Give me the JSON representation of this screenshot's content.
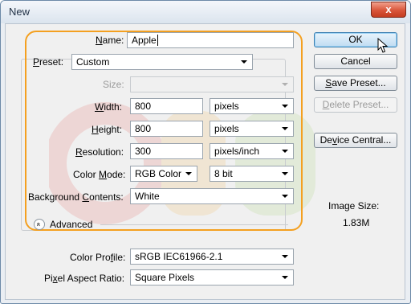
{
  "window": {
    "title": "New",
    "close_glyph": "x"
  },
  "form": {
    "name": {
      "label_pre": "",
      "label_mn": "N",
      "label_post": "ame:",
      "value": "Apple"
    },
    "preset": {
      "label_pre": "",
      "label_mn": "P",
      "label_post": "reset:",
      "value": "Custom"
    },
    "size": {
      "label": "Size:",
      "value": ""
    },
    "width": {
      "label_pre": "",
      "label_mn": "W",
      "label_post": "idth:",
      "value": "800",
      "unit": "pixels"
    },
    "height": {
      "label_pre": "",
      "label_mn": "H",
      "label_post": "eight:",
      "value": "800",
      "unit": "pixels"
    },
    "resolution": {
      "label_pre": "",
      "label_mn": "R",
      "label_post": "esolution:",
      "value": "300",
      "unit": "pixels/inch"
    },
    "color_mode": {
      "label_pre": "Color ",
      "label_mn": "M",
      "label_post": "ode:",
      "value": "RGB Color",
      "depth": "8 bit"
    },
    "background": {
      "label_pre": "Background ",
      "label_mn": "C",
      "label_post": "ontents:",
      "value": "White"
    }
  },
  "advanced": {
    "toggle_glyph": "«",
    "label": "Advanced",
    "color_profile": {
      "label_pre": "Color Pro",
      "label_mn": "f",
      "label_post": "ile:",
      "value": "sRGB IEC61966-2.1"
    },
    "pixel_aspect": {
      "label_pre": "Pi",
      "label_mn": "x",
      "label_post": "el Aspect Ratio:",
      "value": "Square Pixels"
    }
  },
  "buttons": {
    "ok": "OK",
    "cancel": "Cancel",
    "save_preset": {
      "pre": "",
      "mn": "S",
      "post": "ave Preset..."
    },
    "delete_preset": {
      "pre": "",
      "mn": "D",
      "post": "elete Preset..."
    },
    "device_central": {
      "pre": "De",
      "mn": "v",
      "post": "ice Central..."
    }
  },
  "image_size": {
    "label": "Image Size:",
    "value": "1.83M"
  },
  "colors": {
    "highlight": "#f4a020",
    "accent_default_button": "#3c7fb1",
    "close_button": "#d9553a",
    "watermark": [
      "#e0302a",
      "#f2a21d",
      "#8bc34a"
    ]
  },
  "icons": {
    "close": "close-icon",
    "advanced_toggle": "chevron-up-double-icon",
    "dropdown": "chevron-down-icon",
    "cursor": "mouse-pointer-icon"
  }
}
